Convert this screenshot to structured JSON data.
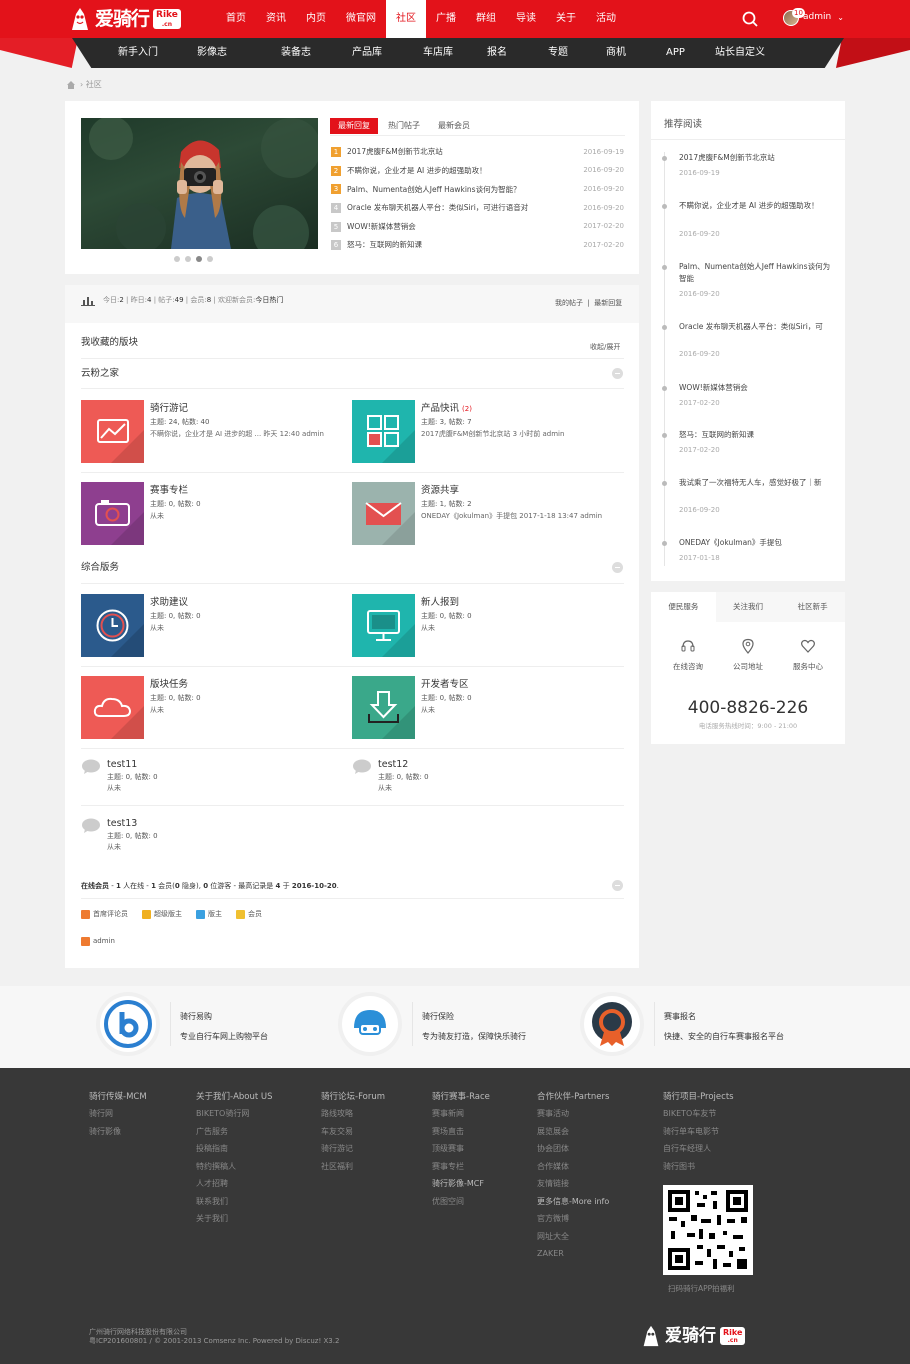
{
  "header": {
    "brand": "爱骑行",
    "badge_top": "Rike",
    "badge_bottom": ".cn",
    "nav": [
      "首页",
      "资讯",
      "内页",
      "微官网",
      "社区",
      "广播",
      "群组",
      "导读",
      "关于",
      "活动"
    ],
    "active_nav": "社区",
    "notifications": "10",
    "username": "admin",
    "accent_color": "#e3121a"
  },
  "subnav": [
    "新手入门",
    "影像志",
    "装备志",
    "产品库",
    "车店库",
    "报名",
    "专题",
    "商机",
    "APP",
    "站长自定义"
  ],
  "breadcrumb": {
    "current": "社区"
  },
  "hot": {
    "tabs": [
      "最新回复",
      "热门帖子",
      "最新会员"
    ],
    "items": [
      {
        "n": "1",
        "title": "2017虎腹F&M创新节北京站",
        "date": "2016-09-19"
      },
      {
        "n": "2",
        "title": "不瞒你说，企业才是 AI 进步的超强助攻！",
        "date": "2016-09-20"
      },
      {
        "n": "3",
        "title": "Palm、Numenta创始人Jeff Hawkins谈何为智能？",
        "date": "2016-09-20"
      },
      {
        "n": "4",
        "title": "Oracle 发布聊天机器人平台：类似Siri，可进行语音对",
        "date": "2016-09-20"
      },
      {
        "n": "5",
        "title": "WOW!新媒体营销会",
        "date": "2017-02-20"
      },
      {
        "n": "6",
        "title": "怒马：互联网的新知课",
        "date": "2017-02-20"
      }
    ]
  },
  "stats": {
    "today_label": "今日:",
    "today": "2",
    "yesterday_label": "昨日:",
    "yesterday": "4",
    "posts_label": "帖子:",
    "posts": "49",
    "members_label": "会员:",
    "members": "8",
    "welcome_label": "欢迎新会员:",
    "welcome": "今日热门",
    "my_posts": "我的帖子",
    "latest_reply": "最新回复"
  },
  "favorites": {
    "title": "我收藏的版块",
    "toggle": "收起/展开"
  },
  "groups": [
    {
      "name": "云粉之家",
      "forums": [
        {
          "name": "骑行游记",
          "new": "",
          "stat": "主题: 24, 帖数: 40",
          "last": "不瞒你说，企业才是 AI 进步的超 ... 昨天 12:40 admin"
        },
        {
          "name": "产品快讯",
          "new": "(2)",
          "stat": "主题: 3, 帖数: 7",
          "last": "2017虎腹F&M创新节北京站 3 小时前 admin"
        },
        {
          "name": "赛事专栏",
          "new": "",
          "stat": "主题: 0, 帖数: 0",
          "last": "从未"
        },
        {
          "name": "资源共享",
          "new": "",
          "stat": "主题: 1, 帖数: 2",
          "last": "ONEDAY《Jokulman》手提包 2017-1-18 13:47 admin"
        }
      ]
    },
    {
      "name": "综合版务",
      "forums": [
        {
          "name": "求助建议",
          "new": "",
          "stat": "主题: 0, 帖数: 0",
          "last": "从未"
        },
        {
          "name": "新人报到",
          "new": "",
          "stat": "主题: 0, 帖数: 0",
          "last": "从未"
        },
        {
          "name": "版块任务",
          "new": "",
          "stat": "主题: 0, 帖数: 0",
          "last": "从未"
        },
        {
          "name": "开发者专区",
          "new": "",
          "stat": "主题: 0, 帖数: 0",
          "last": "从未"
        }
      ]
    }
  ],
  "simple_forums": [
    {
      "name": "test11",
      "stat": "主题: 0, 帖数: 0",
      "last": "从未"
    },
    {
      "name": "test12",
      "stat": "主题: 0, 帖数: 0",
      "last": "从未"
    },
    {
      "name": "test13",
      "stat": "主题: 0, 帖数: 0",
      "last": "从未"
    }
  ],
  "online": {
    "label": "在线会员",
    "text1": " - ",
    "people": "1",
    "text2": " 人在线 - ",
    "members": "1",
    "text3": " 会员(",
    "hidden": "0",
    "text4": " 隐身), ",
    "guests": "0",
    "text5": " 位游客 - 最高记录是 ",
    "record": "4",
    "text6": " 于 ",
    "record_date": "2016-10-20",
    "text7": "."
  },
  "legend": [
    "首席评论员",
    "超级版主",
    "版主",
    "会员"
  ],
  "online_user": "admin",
  "recommend": {
    "title": "推荐阅读",
    "items": [
      {
        "title": "2017虎腹F&M创新节北京站",
        "date": "2016-09-19"
      },
      {
        "title": "不瞒你说，企业才是 AI 进步的超强助攻！",
        "date": "2016-09-20"
      },
      {
        "title": "Palm、Numenta创始人Jeff Hawkins谈何为智能",
        "date": "2016-09-20"
      },
      {
        "title": "Oracle 发布聊天机器人平台：类似Siri，可",
        "date": "2016-09-20"
      },
      {
        "title": "WOW!新媒体营销会",
        "date": "2017-02-20"
      },
      {
        "title": "怒马：互联网的新知课",
        "date": "2017-02-20"
      },
      {
        "title": "我试乘了一次福特无人车，感觉好极了｜新",
        "date": "2016-09-20"
      },
      {
        "title": "ONEDAY《Jokulman》手提包",
        "date": "2017-01-18"
      }
    ]
  },
  "service": {
    "tabs": [
      "便民服务",
      "关注我们",
      "社区新手"
    ],
    "items": [
      "在线咨询",
      "公司地址",
      "服务中心"
    ],
    "phone": "400-8826-226",
    "hours": "电话服务热线时间：9:00 - 21:00"
  },
  "features": [
    {
      "title": "骑行易购",
      "desc": "专业自行车网上购物平台"
    },
    {
      "title": "骑行保险",
      "desc": "专为骑友打造，保障快乐骑行"
    },
    {
      "title": "赛事报名",
      "desc": "快捷、安全的自行车赛事报名平台"
    }
  ],
  "footer": {
    "columns": [
      {
        "head": "骑行传媒-MCM",
        "links": [
          "骑行网",
          "骑行影像"
        ]
      },
      {
        "head": "关于我们-About US",
        "links": [
          "BIKETO骑行网",
          "广告服务",
          "投稿指南",
          "特约撰稿人",
          "人才招聘",
          "联系我们",
          "关于我们"
        ]
      },
      {
        "head": "骑行论坛-Forum",
        "links": [
          "路线攻略",
          "车友交易",
          "骑行游记",
          "社区福利"
        ]
      },
      {
        "head": "骑行赛事-Race",
        "links": [
          "赛事新闻",
          "赛场直击",
          "顶级赛事",
          "赛事专栏",
          "骑行影像-MCF",
          "优图空间"
        ]
      },
      {
        "head": "合作伙伴-Partners",
        "links": [
          "赛事活动",
          "展览展会",
          "协会团体",
          "合作媒体",
          "友情链接",
          "更多信息-More info",
          "官方微博",
          "网址大全",
          "ZAKER"
        ]
      },
      {
        "head": "骑行项目-Projects",
        "links": [
          "BIKETO车友节",
          "骑行单车电影节",
          "自行车经理人",
          "骑行图书"
        ]
      }
    ],
    "qr_note": "扫码骑行APP拍福利",
    "company": "广州骑行网络科技股份有限公司",
    "icp": "粤ICP201600801 / © 2001-2013 Comsenz Inc. Powered by Discuz! X3.2",
    "brand": "爱骑行",
    "badge_top": "Rike",
    "badge_bottom": ".cn"
  },
  "colors": {
    "red": "#e3121a",
    "forum_red": "#ee5a55",
    "forum_teal": "#1fb5ad",
    "forum_purple": "#8e3f8f",
    "forum_gray": "#9bb3ad",
    "forum_blue": "#2b5a8c",
    "dark": "#2a2a2a",
    "footer": "#383838"
  }
}
